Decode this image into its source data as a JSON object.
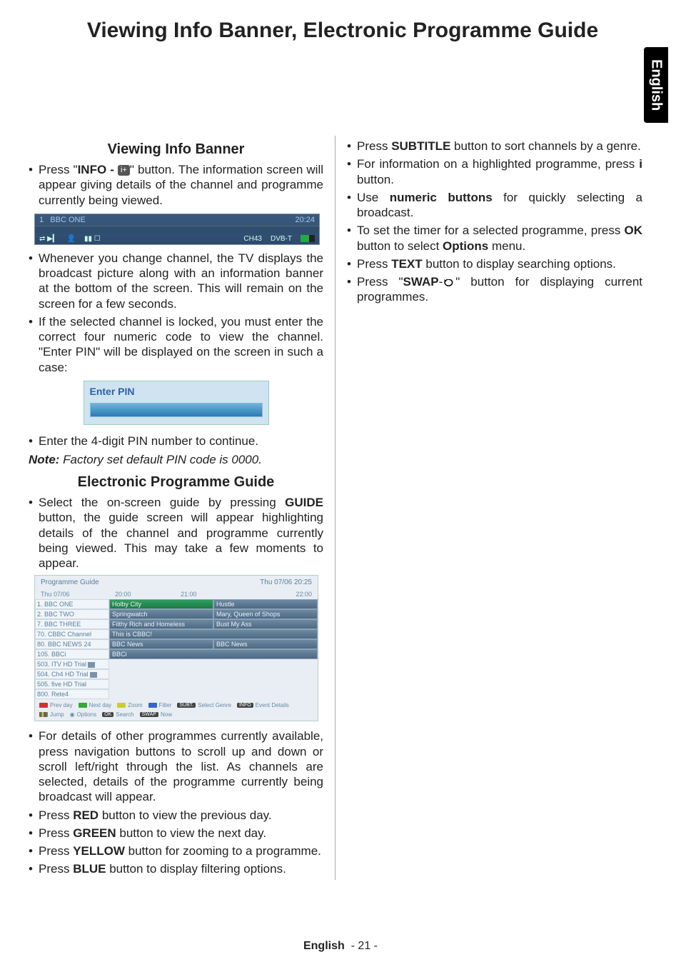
{
  "title": "Viewing Info Banner, Electronic Programme Guide",
  "langTab": "English",
  "footer": {
    "lang": "English",
    "page": "- 21 -"
  },
  "left": {
    "head1": "Viewing Info Banner",
    "li1_a": "Press \"",
    "li1_b": "INFO - ",
    "li1_icon": "i+",
    "li1_c": "\" button. The information screen will appear giving details of the channel and programme currently being viewed.",
    "infoBanner": {
      "num": "1",
      "name": "BBC ONE",
      "time": "20:24",
      "ch": "CH43",
      "sys": "DVB-T"
    },
    "li2": "Whenever you change channel, the TV displays the broadcast picture along with an information banner at the bottom of the screen. This will remain on the screen for a few seconds.",
    "li3": "If the selected channel is locked, you must enter the correct four numeric code to view the channel. \"Enter PIN\" will be displayed on the screen in such a case:",
    "pinLabel": "Enter PIN",
    "li4": "Enter the 4-digit PIN number to continue.",
    "note_b": "Note:",
    "note_i": " Factory set default PIN code is 0000.",
    "head2": "Electronic Programme Guide",
    "li5_a": "Select the on-screen guide by pressing ",
    "li5_b": "GUIDE",
    "li5_c": " button, the guide screen will appear highlighting details of the channel and programme currently being viewed. This may take a few moments to appear.",
    "epg": {
      "title": "Programme Guide",
      "date": "Thu 07/06 20:25",
      "timeHead": [
        "Thu 07/06",
        "20:00",
        "21:00",
        "22:00"
      ],
      "rows": [
        {
          "ch": "1. BBC ONE",
          "p1": "Holby City",
          "p2": "Hustle",
          "sel": true
        },
        {
          "ch": "2. BBC TWO",
          "p1": "Springwatch",
          "p2": "Mary, Queen of Shops"
        },
        {
          "ch": "7. BBC THREE",
          "p1": "Filthy Rich and Homeless",
          "p2": "Bust My Ass"
        },
        {
          "ch": "70. CBBC Channel",
          "p1": "This is CBBC!",
          "p2": ""
        },
        {
          "ch": "80. BBC NEWS 24",
          "p1": "BBC News",
          "p2": "BBC News"
        },
        {
          "ch": "105. BBCi",
          "p1": "BBCi",
          "p2": ""
        },
        {
          "ch": "503. ITV HD Trial",
          "icon": true
        },
        {
          "ch": "504. Ch4 HD Trial",
          "icon": true
        },
        {
          "ch": "505. five HD Trial"
        },
        {
          "ch": "800. Rete4"
        }
      ],
      "keys": {
        "prev": "Prev day",
        "next": "Next day",
        "zoom": "Zoom",
        "filter": "Filter",
        "genre": "Select Genre",
        "details": "Event Details",
        "jump": "Jump",
        "options": "Options",
        "search": "Search",
        "now": "Now",
        "subt": "SUBT.",
        "info": "INFO",
        "ok": "OK",
        "swap": "SWAP"
      }
    },
    "li6": "For details of other programmes currently available, press navigation buttons to scroll up and down or scroll left/right through the list. As channels are selected, details of the programme currently being broadcast will appear.",
    "li7_a": "Press ",
    "li7_b": "RED",
    "li7_c": " button to view the previous day.",
    "li8_a": "Press ",
    "li8_b": "GREEN",
    "li8_c": " button to view the next day.",
    "li9_a": "Press ",
    "li9_b": "YELLOW",
    "li9_c": " button for zooming to a programme.",
    "li10_a": "Press ",
    "li10_b": "BLUE",
    "li10_c": " button to display filtering options."
  },
  "right": {
    "li1_a": "Press ",
    "li1_b": "SUBTITLE",
    "li1_c": " button to sort channels by a genre.",
    "li2_a": "For information on a highlighted programme, press ",
    "li2_b": "i",
    "li2_c": " button.",
    "li3_a": "Use ",
    "li3_b": "numeric buttons",
    "li3_c": " for quickly selecting a broadcast.",
    "li4_a": "To set the timer for a selected programme, press ",
    "li4_b": "OK",
    "li4_c": " button to select ",
    "li4_d": "Options",
    "li4_e": " menu.",
    "li5_a": "Press ",
    "li5_b": "TEXT",
    "li5_c": " button to display searching options.",
    "li6_a": "Press \"",
    "li6_b": "SWAP",
    "li6_c": "-",
    "li6_d": "\" button for displaying current programmes."
  }
}
